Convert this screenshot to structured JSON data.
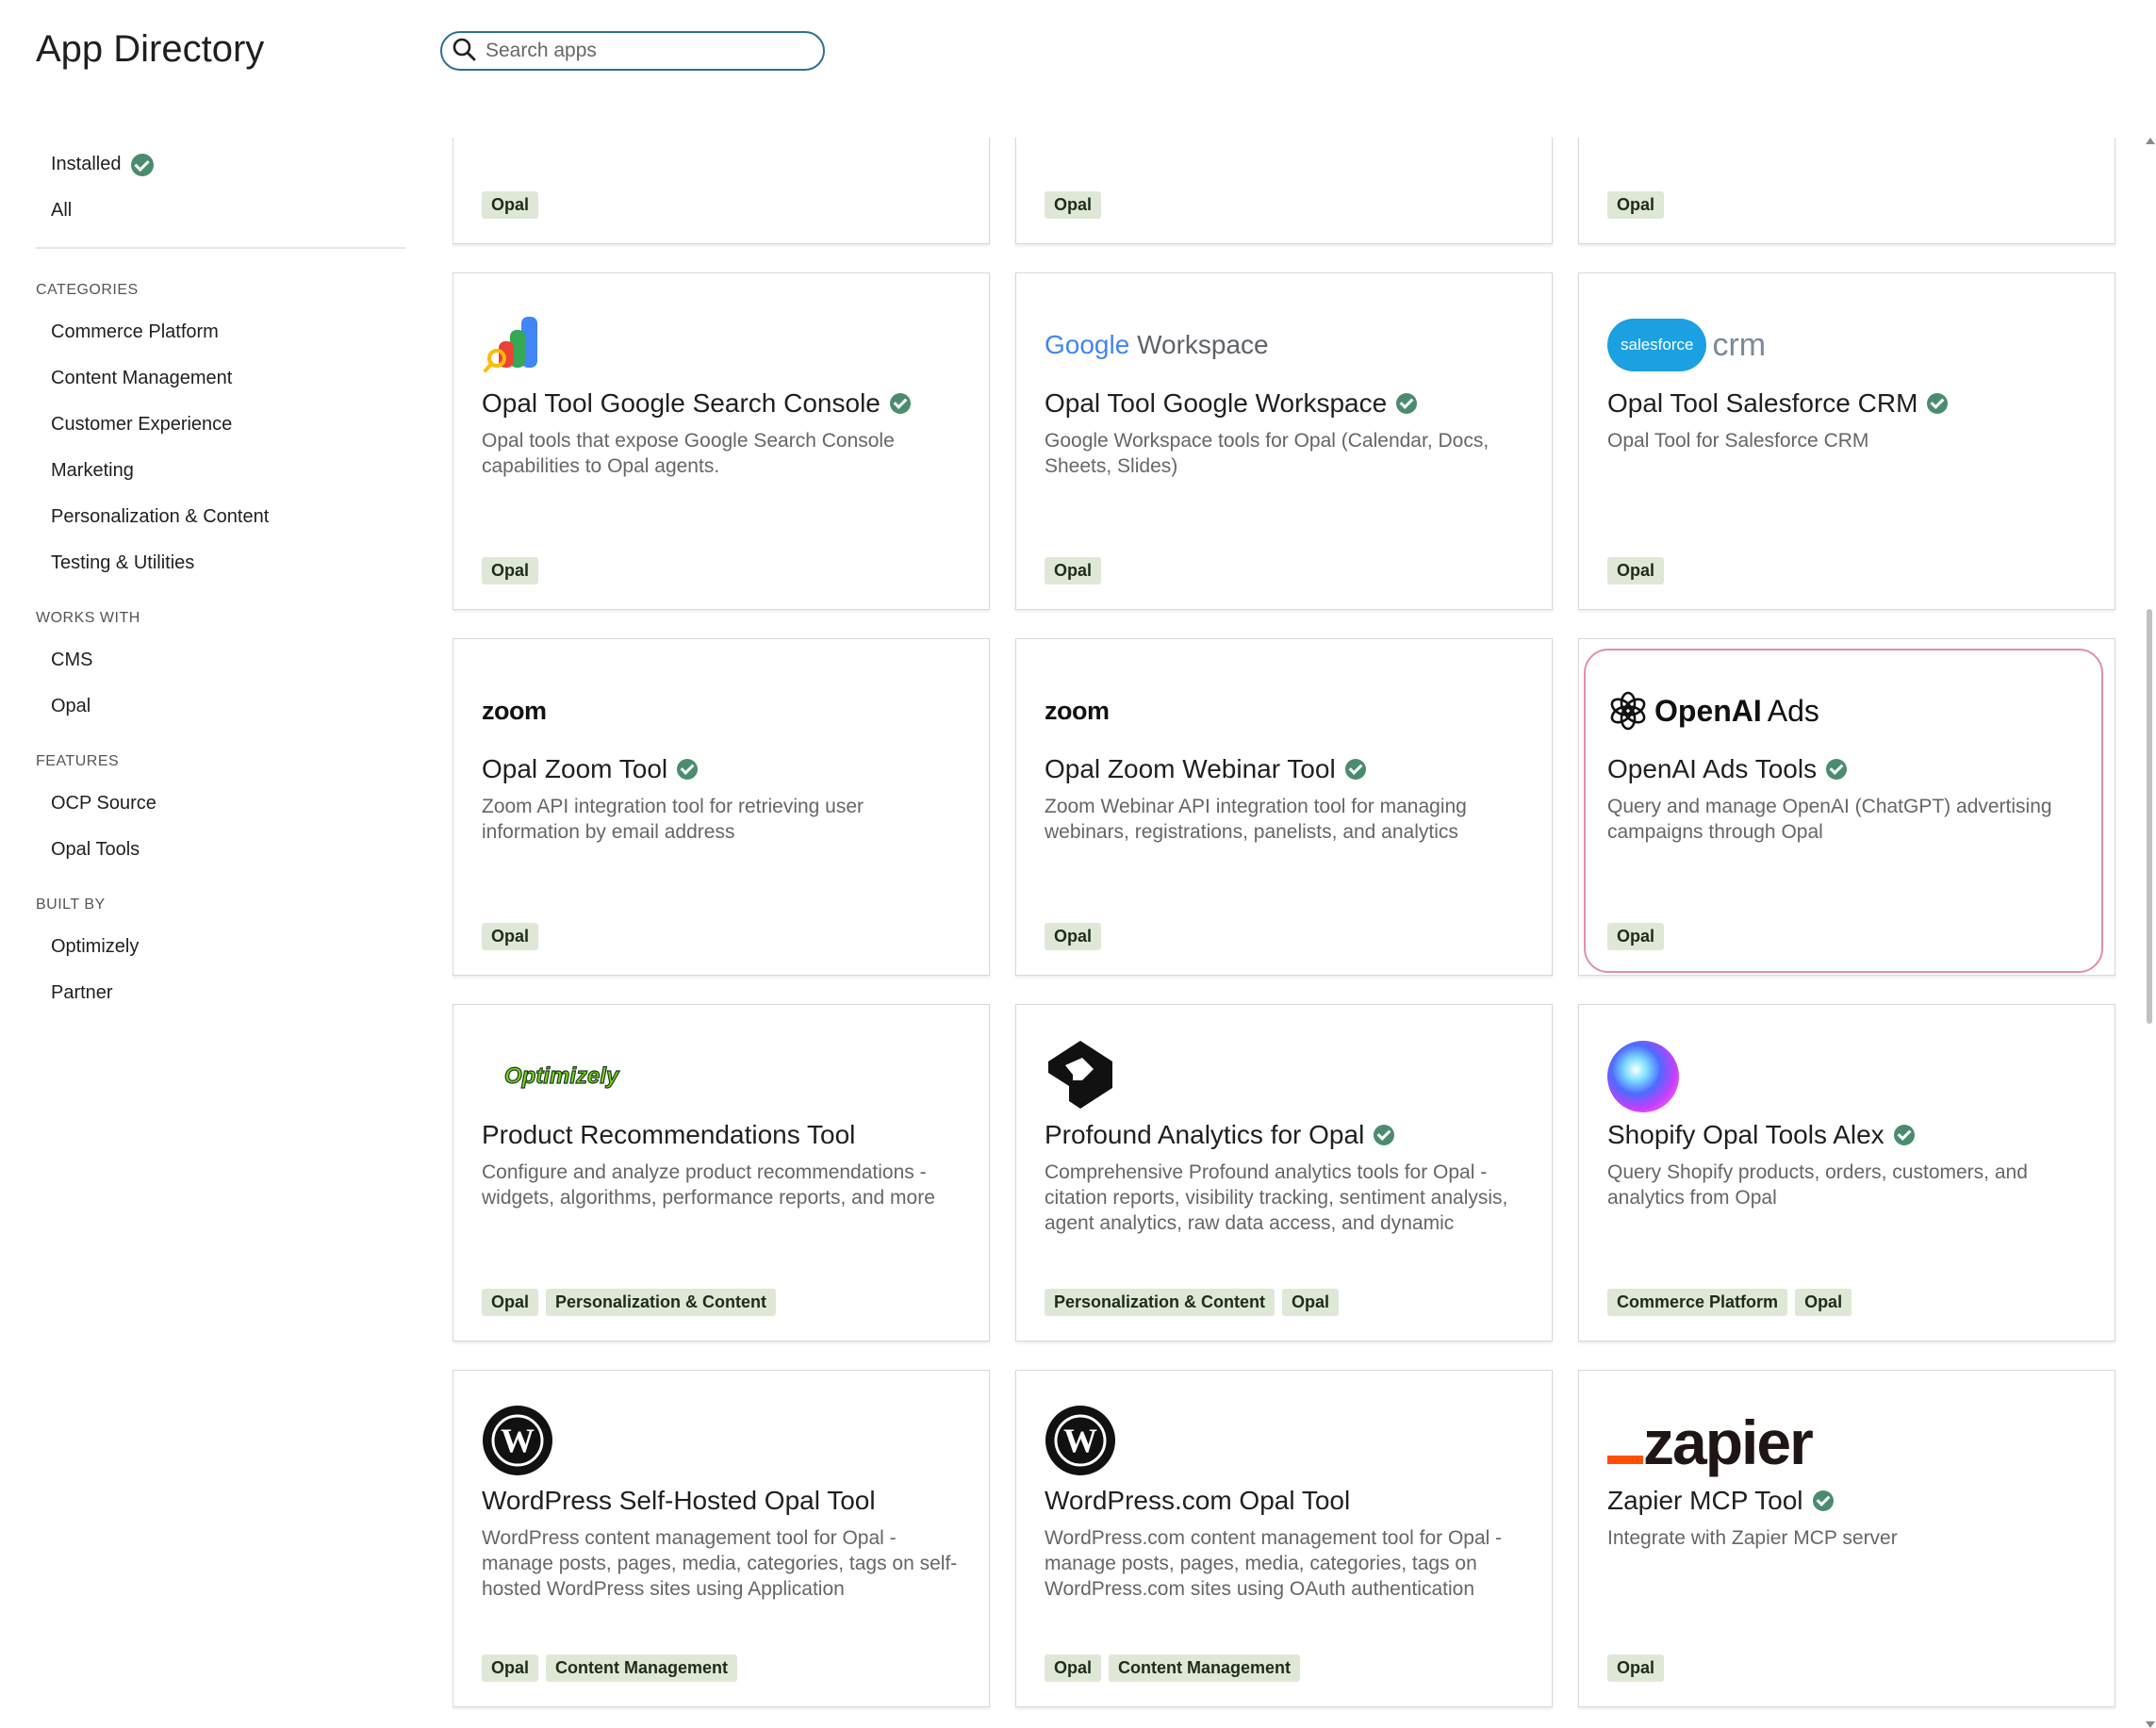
{
  "header": {
    "title": "App Directory"
  },
  "search": {
    "placeholder": "Search apps"
  },
  "sidebar": {
    "status": [
      {
        "label": "Installed",
        "checked": true
      },
      {
        "label": "All",
        "checked": false
      }
    ],
    "categories_label": "CATEGORIES",
    "categories": [
      "Commerce Platform",
      "Content Management",
      "Customer Experience",
      "Marketing",
      "Personalization & Content",
      "Testing & Utilities"
    ],
    "works_with_label": "WORKS WITH",
    "works_with": [
      "CMS",
      "Opal"
    ],
    "features_label": "FEATURES",
    "features": [
      "OCP Source",
      "Opal Tools"
    ],
    "built_by_label": "BUILT BY",
    "built_by": [
      "Optimizely",
      "Partner"
    ]
  },
  "logos": {
    "google_workspace": {
      "google": "Google",
      "workspace": "Workspace"
    },
    "salesforce": {
      "cloud": "salesforce",
      "crm": "crm"
    },
    "zoom": "zoom",
    "openai": {
      "open": "OpenAI",
      "ads": "Ads"
    },
    "optimizely": "Optimizely",
    "zapier": "zapier"
  },
  "colors": {
    "tag_bg": "#dfe8d6",
    "check_green": "#4b8c6f",
    "search_border": "#2f6f8f",
    "focus_ring": "#e08fb0"
  },
  "cards": [
    {
      "title": "",
      "desc": "",
      "verified": false,
      "tags": [
        "Opal"
      ],
      "logo": ""
    },
    {
      "title": "",
      "desc": "",
      "verified": false,
      "tags": [
        "Opal"
      ],
      "logo": ""
    },
    {
      "title": "",
      "desc": "",
      "verified": false,
      "tags": [
        "Opal"
      ],
      "logo": ""
    },
    {
      "title": "Opal Tool Google Search Console",
      "desc": "Opal tools that expose Google Search Console capabilities to Opal agents.",
      "verified": true,
      "tags": [
        "Opal"
      ],
      "logo": "search-console"
    },
    {
      "title": "Opal Tool Google Workspace",
      "desc": "Google Workspace tools for Opal (Calendar, Docs, Sheets, Slides)",
      "verified": true,
      "tags": [
        "Opal"
      ],
      "logo": "google-workspace"
    },
    {
      "title": "Opal Tool Salesforce CRM",
      "desc": "Opal Tool for Salesforce CRM",
      "verified": true,
      "tags": [
        "Opal"
      ],
      "logo": "salesforce"
    },
    {
      "title": "Opal Zoom Tool",
      "desc": "Zoom API integration tool for retrieving user information by email address",
      "verified": true,
      "tags": [
        "Opal"
      ],
      "logo": "zoom"
    },
    {
      "title": "Opal Zoom Webinar Tool",
      "desc": "Zoom Webinar API integration tool for managing webinars, registrations, panelists, and analytics",
      "verified": true,
      "tags": [
        "Opal"
      ],
      "logo": "zoom"
    },
    {
      "title": "OpenAI Ads Tools",
      "desc": "Query and manage OpenAI (ChatGPT) advertising campaigns through Opal",
      "verified": true,
      "tags": [
        "Opal"
      ],
      "logo": "openai",
      "focused": true
    },
    {
      "title": "Product Recommendations Tool",
      "desc": "Configure and analyze product recommendations - widgets, algorithms, performance reports, and more",
      "verified": false,
      "tags": [
        "Opal",
        "Personalization & Content"
      ],
      "logo": "optimizely"
    },
    {
      "title": "Profound Analytics for Opal",
      "desc": "Comprehensive Profound analytics tools for Opal - citation reports, visibility tracking, sentiment analysis, agent analytics, raw data access, and dynamic",
      "verified": true,
      "tags": [
        "Personalization & Content",
        "Opal"
      ],
      "logo": "profound"
    },
    {
      "title": "Shopify Opal Tools Alex",
      "desc": "Query Shopify products, orders, customers, and analytics from Opal",
      "verified": true,
      "tags": [
        "Commerce Platform",
        "Opal"
      ],
      "logo": "orb"
    },
    {
      "title": "WordPress Self-Hosted Opal Tool",
      "desc": "WordPress content management tool for Opal - manage posts, pages, media, categories, tags on self-hosted WordPress sites using Application",
      "verified": false,
      "tags": [
        "Opal",
        "Content Management"
      ],
      "logo": "wordpress"
    },
    {
      "title": "WordPress.com Opal Tool",
      "desc": "WordPress.com content management tool for Opal - manage posts, pages, media, categories, tags on WordPress.com sites using OAuth authentication",
      "verified": false,
      "tags": [
        "Opal",
        "Content Management"
      ],
      "logo": "wordpress"
    },
    {
      "title": "Zapier MCP Tool",
      "desc": "Integrate with Zapier MCP server",
      "verified": true,
      "tags": [
        "Opal"
      ],
      "logo": "zapier"
    }
  ]
}
